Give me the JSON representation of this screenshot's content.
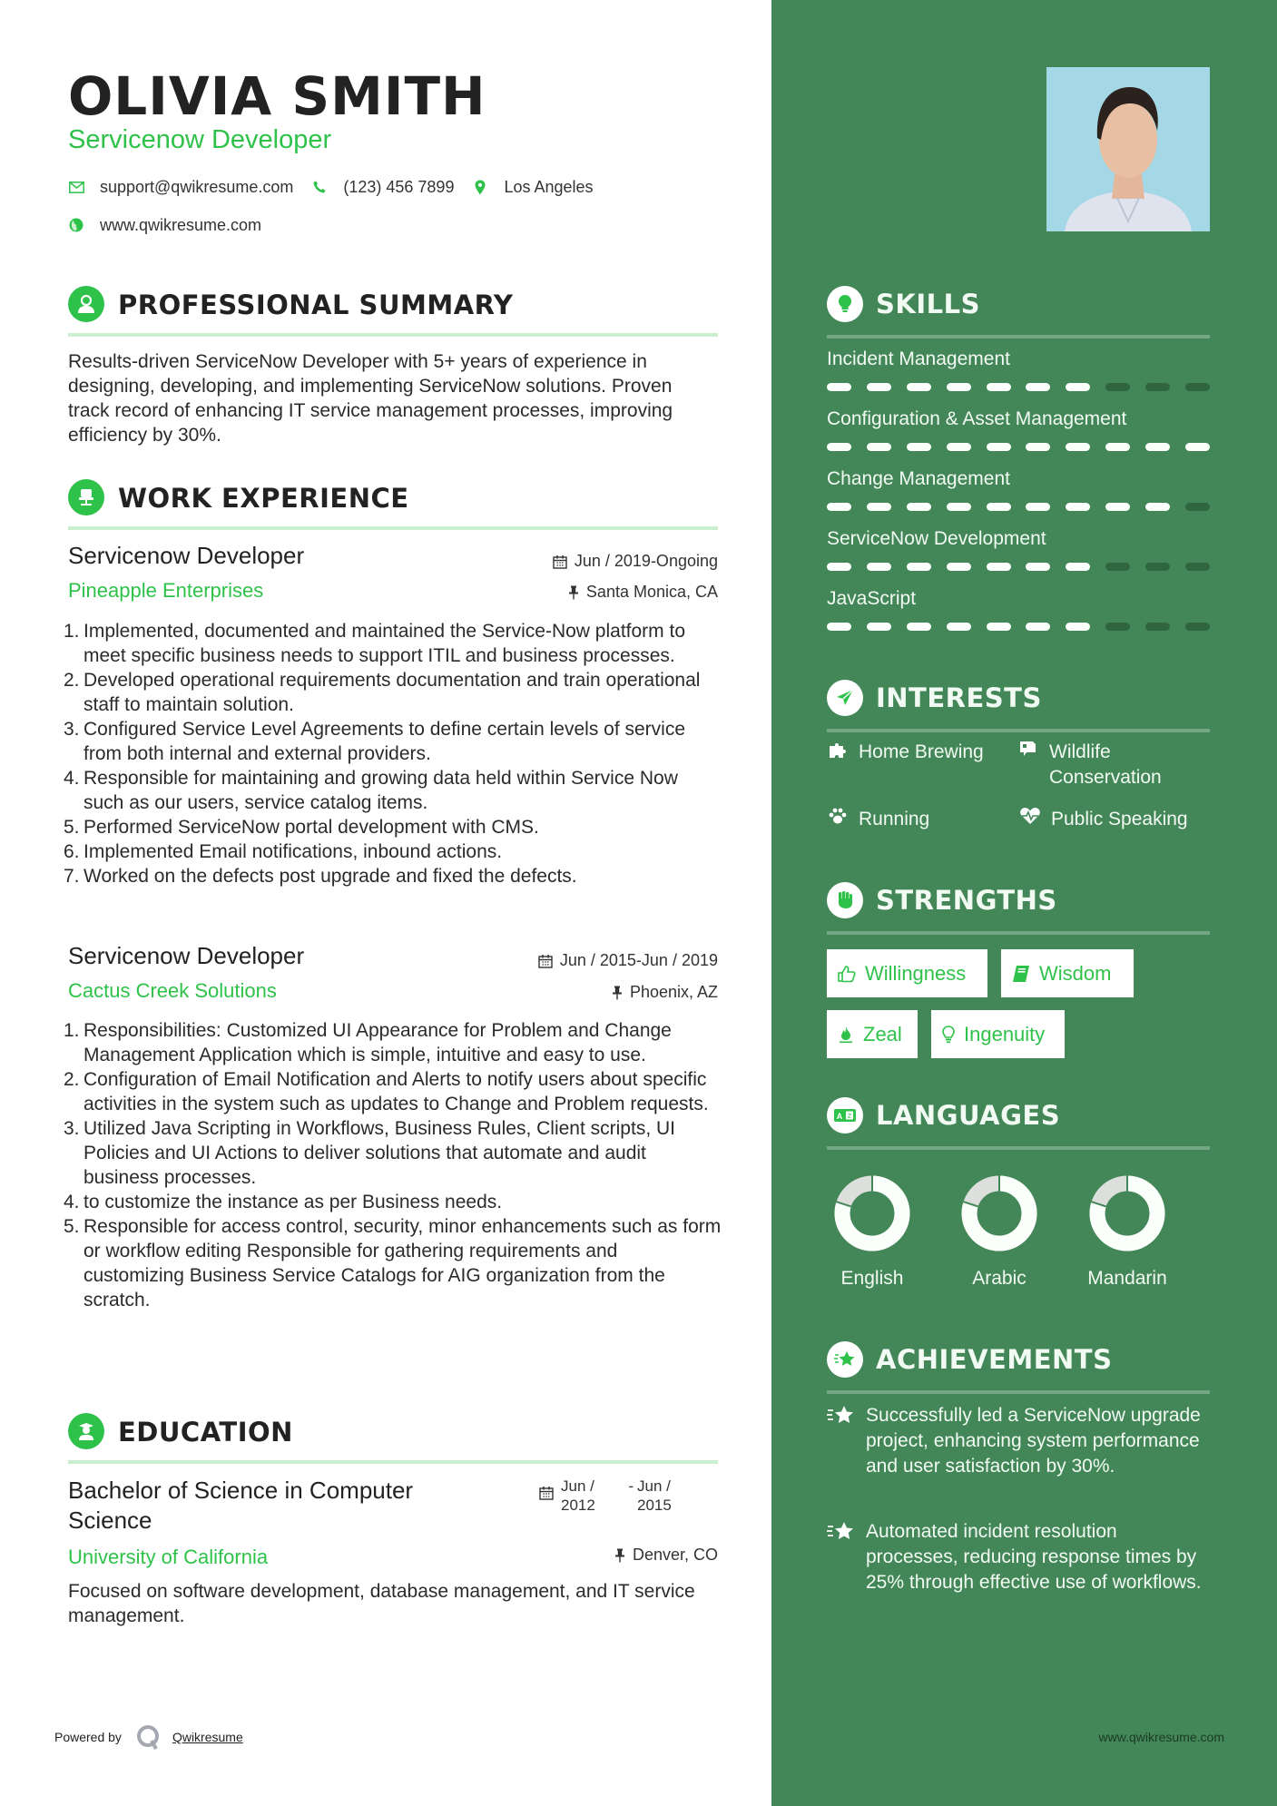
{
  "header": {
    "name": "OLIVIA SMITH",
    "title": "Servicenow Developer",
    "email": "support@qwikresume.com",
    "phone": "(123) 456 7899",
    "location": "Los Angeles",
    "website": "www.qwikresume.com"
  },
  "colors": {
    "accent": "#2fc24a",
    "sidebar": "#438657",
    "section_rule": "#c9efcf"
  },
  "summary": {
    "heading": "PROFESSIONAL SUMMARY",
    "icon": "user-icon",
    "text": "Results-driven ServiceNow Developer with 5+ years of experience in designing, developing, and implementing ServiceNow solutions. Proven track record of enhancing IT service management processes, improving efficiency by 30%."
  },
  "experience": {
    "heading": "WORK EXPERIENCE",
    "icon": "office-chair-icon",
    "jobs": [
      {
        "title": "Servicenow Developer",
        "company": "Pineapple Enterprises",
        "dates": "Jun / 2019-Ongoing",
        "location": "Santa Monica, CA",
        "bullets": [
          "Implemented, documented and maintained the Service-Now platform to meet specific business needs to support ITIL and business processes.",
          "Developed operational requirements documentation and train operational staff to maintain solution.",
          "Configured Service Level Agreements to define certain levels of service from both internal and external providers.",
          "Responsible for maintaining and growing data held within Service Now such as our users, service catalog items.",
          "Performed ServiceNow portal development with CMS.",
          "Implemented Email notifications, inbound actions.",
          "Worked on the defects post upgrade and fixed the defects."
        ]
      },
      {
        "title": "Servicenow Developer",
        "company": "Cactus Creek Solutions",
        "dates": "Jun / 2015-Jun / 2019",
        "location": "Phoenix, AZ",
        "bullets": [
          "Responsibilities: Customized UI Appearance for Problem and Change Management Application which is simple, intuitive and easy to use.",
          "Configuration of Email Notification and Alerts to notify users about specific activities in the system such as updates to Change and Problem requests.",
          "Utilized Java Scripting in Workflows, Business Rules, Client scripts, UI Policies and UI Actions to deliver solutions that automate and audit business processes.",
          "to customize the instance as per Business needs.",
          "Responsible for access control, security, minor enhancements such as form or workflow editing Responsible for gathering requirements and customizing Business Service Catalogs for AIG organization from the scratch."
        ]
      }
    ]
  },
  "education": {
    "heading": "EDUCATION",
    "icon": "graduate-icon",
    "degree": "Bachelor of Science in Computer Science",
    "school": "University of California",
    "start": "Jun / 2012",
    "end": "Jun / 2015",
    "location": "Denver, CO",
    "description": "Focused on software development, database management, and IT service management."
  },
  "skills": {
    "heading": "SKILLS",
    "icon": "lightbulb-icon",
    "scale_max": 10,
    "items": [
      {
        "name": "Incident Management",
        "level": 7
      },
      {
        "name": "Configuration & Asset Management",
        "level": 10
      },
      {
        "name": "Change Management",
        "level": 9
      },
      {
        "name": "ServiceNow Development",
        "level": 7
      },
      {
        "name": "JavaScript",
        "level": 7
      }
    ]
  },
  "interests": {
    "heading": "INTERESTS",
    "icon": "paper-plane-icon",
    "items": [
      {
        "label": "Home Brewing",
        "icon": "puzzle-icon"
      },
      {
        "label": "Wildlife Conservation",
        "icon": "map-icon"
      },
      {
        "label": "Running",
        "icon": "paw-icon"
      },
      {
        "label": "Public Speaking",
        "icon": "heartbeat-icon"
      }
    ]
  },
  "strengths": {
    "heading": "STRENGTHS",
    "icon": "fist-icon",
    "items": [
      {
        "label": "Willingness",
        "icon": "thumbs-up-icon"
      },
      {
        "label": "Wisdom",
        "icon": "book-icon"
      },
      {
        "label": "Zeal",
        "icon": "fire-icon"
      },
      {
        "label": "Ingenuity",
        "icon": "lightbulb-icon"
      }
    ]
  },
  "languages": {
    "heading": "LANGUAGES",
    "icon": "translate-icon",
    "items": [
      {
        "name": "English",
        "proficiency": 0.8
      },
      {
        "name": "Arabic",
        "proficiency": 0.8
      },
      {
        "name": "Mandarin",
        "proficiency": 0.8
      }
    ]
  },
  "achievements": {
    "heading": "ACHIEVEMENTS",
    "icon": "star-badge-icon",
    "items": [
      "Successfully led a ServiceNow upgrade project, enhancing system performance and user satisfaction by 30%.",
      "Automated incident resolution processes, reducing response times by 25% through effective use of workflows."
    ]
  },
  "footer": {
    "powered_by": "Powered by",
    "brand": "Qwikresume",
    "website": "www.qwikresume.com"
  }
}
